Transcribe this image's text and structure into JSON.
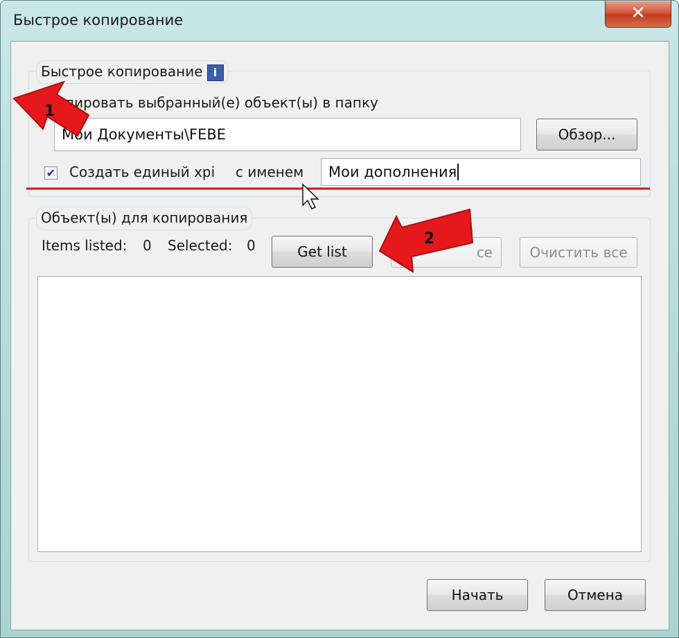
{
  "window": {
    "title": "Быстрое копирование",
    "close_glyph": "✕"
  },
  "copy_group": {
    "legend": "Быстрое копирование",
    "info_glyph": "i",
    "copy_to_label": "пировать выбранный(е) объект(ы) в папку",
    "folder_value": "Мои Документы\\FEBE",
    "browse_label": "Обзор...",
    "create_xpi_label": "Создать единый xpi",
    "create_xpi_checked": true,
    "with_name_label": "с именем",
    "name_value": "Мои дополнения"
  },
  "objects_group": {
    "legend": "Объект(ы) для копирования",
    "items_listed_label": "Items listed:",
    "items_listed_value": "0",
    "selected_label": "Selected:",
    "selected_value": "0",
    "get_list_label": "Get list",
    "select_all_partial_label": "се",
    "clear_all_label": "Очистить все",
    "items": []
  },
  "footer": {
    "start_label": "Начать",
    "cancel_label": "Отмена"
  },
  "annotations": {
    "marker_1": "1",
    "marker_2": "2",
    "arrow_color": "#e5191c",
    "underline_color": "#c41d1d"
  },
  "icons": [
    "close-icon",
    "info-icon",
    "checkmark-icon",
    "mouse-cursor-icon",
    "red-arrow-icon"
  ]
}
